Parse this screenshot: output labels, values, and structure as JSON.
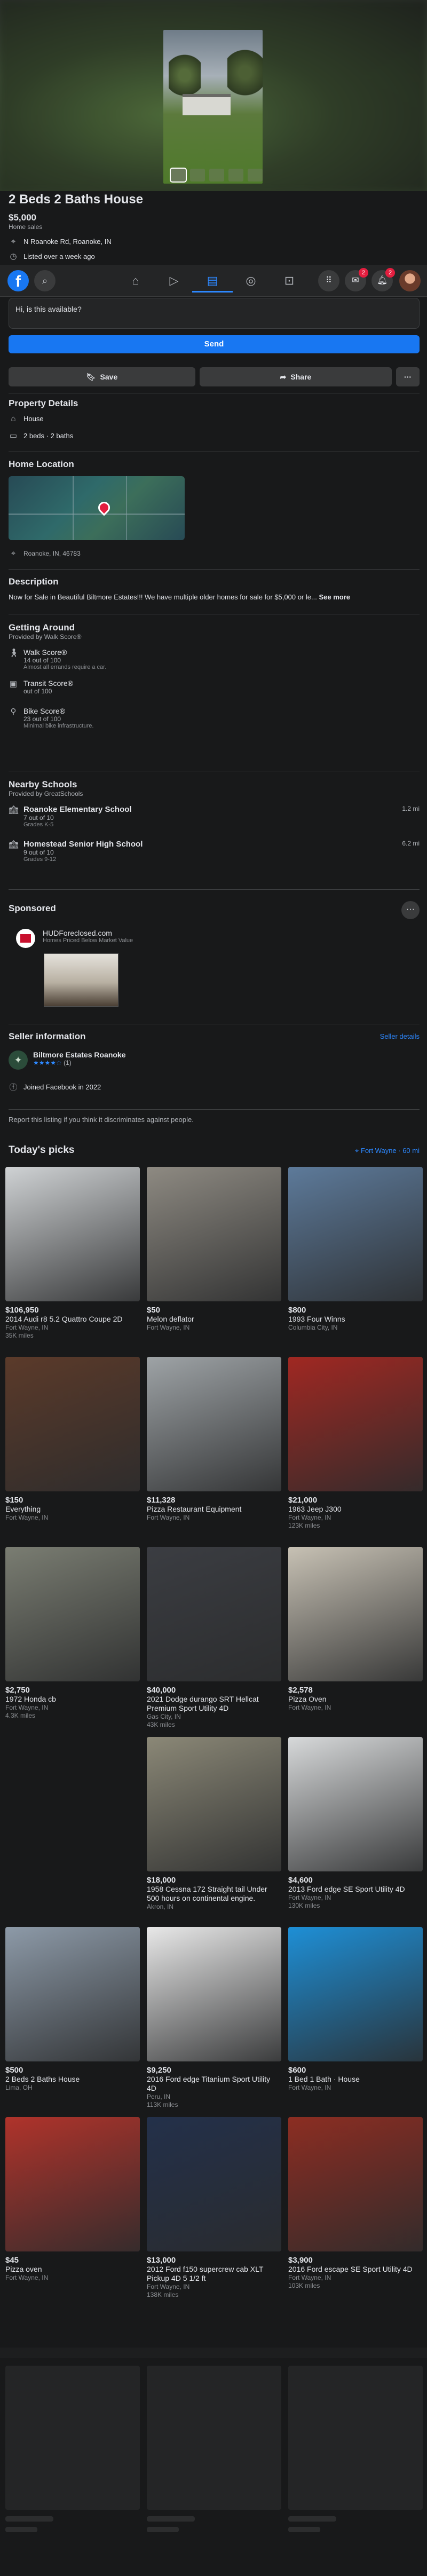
{
  "listing": {
    "title": "2 Beds 2 Baths House",
    "price": "$5,000",
    "price_sub": "Home sales",
    "address": "N Roanoke Rd, Roanoke, IN",
    "listed": "Listed over a week ago"
  },
  "nav": {
    "tabs": [
      "home-icon",
      "video-icon",
      "marketplace-icon",
      "groups-icon",
      "gaming-icon"
    ],
    "badges": {
      "messenger": "2",
      "notifications": "2"
    }
  },
  "message": {
    "text": "Hi, is this available?",
    "send_label": "Send"
  },
  "actions": {
    "save_label": "Save",
    "share_label": "Share",
    "more_label": "···"
  },
  "property": {
    "heading": "Property Details",
    "type": "House",
    "beds_baths": "2 beds · 2 baths"
  },
  "location": {
    "heading": "Home Location",
    "place": "Roanoke, IN, 46783"
  },
  "description": {
    "heading": "Description",
    "text": "Now for Sale in Beautiful Biltmore Estates!!! We have multiple older homes for sale for $5,000 or le...",
    "see_more": "See more"
  },
  "getting_around": {
    "heading": "Getting Around",
    "provider": "Provided by Walk Score®",
    "scores": [
      {
        "name": "Walk Score®",
        "value": "14 out of 100",
        "note": "Almost all errands require a car."
      },
      {
        "name": "Transit Score®",
        "value": "out of 100",
        "note": ""
      },
      {
        "name": "Bike Score®",
        "value": "23 out of 100",
        "note": "Minimal bike infrastructure."
      }
    ]
  },
  "schools": {
    "heading": "Nearby Schools",
    "provider": "Provided by GreatSchools",
    "items": [
      {
        "name": "Roanoke Elementary School",
        "rating": "7 out of 10",
        "grades": "Grades K-5",
        "distance": "1.2 mi"
      },
      {
        "name": "Homestead Senior High School",
        "rating": "9 out of 10",
        "grades": "Grades 9-12",
        "distance": "6.2 mi"
      }
    ]
  },
  "sponsored": {
    "heading": "Sponsored",
    "advertiser": "HUDForeclosed.com",
    "tagline": "Homes Priced Below Market Value"
  },
  "seller": {
    "heading": "Seller information",
    "details_link": "Seller details",
    "name": "Biltmore Estates Roanoke",
    "rating_count": "(1)",
    "rating_stars": 4,
    "joined": "Joined Facebook in 2022",
    "report": "Report this listing if you think it discriminates against people."
  },
  "picks": {
    "heading": "Today's picks",
    "location": "Fort Wayne · 60 mi",
    "items": [
      {
        "price": "$106,950",
        "title": "2014 Audi r8 5.2 Quattro Coupe 2D",
        "loc": "Fort Wayne, IN",
        "extra": "35K miles",
        "color": "#cfd2d4"
      },
      {
        "price": "$50",
        "title": "Melon deflator",
        "loc": "Fort Wayne, IN",
        "extra": "",
        "color": "#8e8a82"
      },
      {
        "price": "$800",
        "title": "1993 Four Winns",
        "loc": "Columbia City, IN",
        "extra": "",
        "color": "#5d7a9a"
      },
      {
        "price": "$150",
        "title": "Everything",
        "loc": "Fort Wayne, IN",
        "extra": "",
        "color": "#5b3a2a"
      },
      {
        "price": "$11,328",
        "title": "Pizza Restaurant Equipment",
        "loc": "Fort Wayne, IN",
        "extra": "",
        "color": "#9ea3a6"
      },
      {
        "price": "$21,000",
        "title": "1963 Jeep J300",
        "loc": "Fort Wayne, IN",
        "extra": "123K miles",
        "color": "#a02822"
      },
      {
        "price": "$2,750",
        "title": "1972 Honda cb",
        "loc": "Fort Wayne, IN",
        "extra": "4.3K miles",
        "color": "#7a7d72"
      },
      {
        "price": "$40,000",
        "title": "2021 Dodge durango SRT Hellcat Premium Sport Utility 4D",
        "loc": "Gas City, IN",
        "extra": "43K miles",
        "color": "#3b3d42"
      },
      {
        "price": "$2,578",
        "title": "Pizza Oven",
        "loc": "Fort Wayne, IN",
        "extra": "",
        "color": "#c7c1b4"
      },
      {
        "price": "",
        "title": "",
        "loc": "",
        "extra": "",
        "color": ""
      },
      {
        "price": "$18,000",
        "title": "1958 Cessna 172 Straight tail Under 500 hours on continental engine.",
        "loc": "Akron, IN",
        "extra": "",
        "color": "#8b8877"
      },
      {
        "price": "$4,600",
        "title": "2013 Ford edge SE Sport Utility 4D",
        "loc": "Fort Wayne, IN",
        "extra": "130K miles",
        "color": "#d7d9da"
      },
      {
        "price": "$500",
        "title": "2 Beds 2 Baths House",
        "loc": "Lima, OH",
        "extra": "",
        "color": "#8d9aa8"
      },
      {
        "price": "$9,250",
        "title": "2016 Ford edge Titanium Sport Utility 4D",
        "loc": "Peru, IN",
        "extra": "113K miles",
        "color": "#e8e8e8"
      },
      {
        "price": "$600",
        "title": "1 Bed 1 Bath · House",
        "loc": "Fort Wayne, IN",
        "extra": "",
        "color": "#1e8fd6"
      },
      {
        "price": "$45",
        "title": "Pizza oven",
        "loc": "Fort Wayne, IN",
        "extra": "",
        "color": "#b0332b"
      },
      {
        "price": "$13,000",
        "title": "2012 Ford f150 supercrew cab XLT Pickup 4D 5 1/2 ft",
        "loc": "Fort Wayne, IN",
        "extra": "138K miles",
        "color": "#23304a"
      },
      {
        "price": "$3,900",
        "title": "2016 Ford escape SE Sport Utility 4D",
        "loc": "Fort Wayne, IN",
        "extra": "103K miles",
        "color": "#8c2d22"
      }
    ]
  },
  "colors": {
    "accent": "#1877f2",
    "background": "#18191a",
    "card": "#242526"
  }
}
